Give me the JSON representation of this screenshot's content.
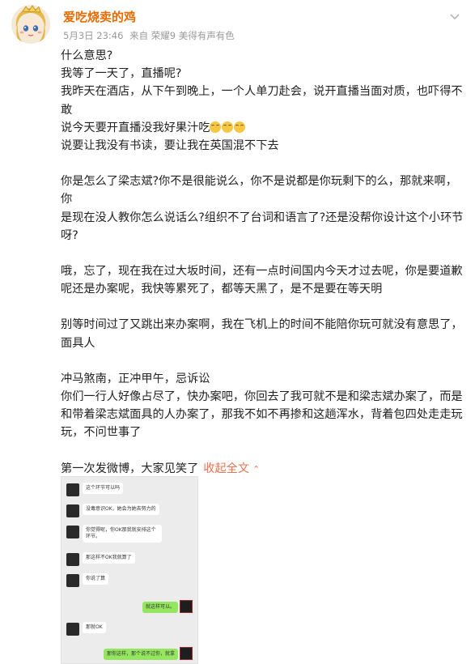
{
  "header": {
    "username": "爱吃烧卖的鸡",
    "date": "5月3日 23:46",
    "source": "来自 荣耀9 美得有声有色"
  },
  "post": {
    "lines": [
      "什么意思?",
      "我等了一天了，直播呢?",
      "我昨天在酒店，从下午到晚上，一个人单刀赴会，说开直播当面对质，也吓得不",
      "敢",
      "说今天要开直播没我好果汁吃",
      "说要让我没有书读，要让我在英国混不下去",
      "",
      "你是怎么了梁志斌?你不是很能说么，你不是说都是你玩剩下的么，那就来啊，你",
      "是现在没人教你怎么说话么?组织不了台词和语言了?还是没帮你设计这个小环节",
      "呀?",
      "",
      "哦，忘了，现在我在过大坂时间，还有一点时间国内今天才过去呢，你是要道歉",
      "呢还是办案呢，我快等累死了，都等天黑了，是不是要在等天明",
      "",
      "别等时间过了又跳出来办案啊，我在飞机上的时间不能陪你玩可就没有意思了，",
      "面具人",
      "",
      "冲马煞南，正冲甲午，忌诉讼",
      "你们一行人好像占尽了，快办案吧，你回去了我可就不是和梁志斌办案了，而是",
      "和带着梁志斌面具的人办案了，那我不如不再掺和这趟浑水，背着包四处走走玩",
      "玩，不问世事了",
      "",
      "第一次发微博，大家见笑了"
    ],
    "emoji_count": 3,
    "collapse_label": "收起全文",
    "collapse_chevron": "⌃"
  },
  "chat_screenshot": {
    "left_messages": [
      "这个环节可以吗",
      "没毒意识OK，她会为她去努力的",
      "你觉得呢，你OK那我就安排这个环节。",
      "那这样不OK我就算了",
      "你说了算",
      "那就OK"
    ],
    "right_messages": [
      "就这样可以。",
      "那你这样，那个说不过你，就拿"
    ]
  },
  "colors": {
    "username": "#e86b00",
    "meta": "#9a9a9a",
    "link": "#eb7350"
  }
}
